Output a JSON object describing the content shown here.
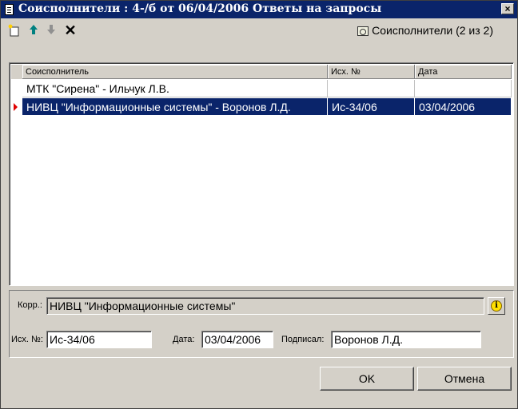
{
  "window": {
    "title": "Соисполнители : 4-/б от 06/04/2006 Ответы на запросы",
    "close_label": "×"
  },
  "toolbar": {
    "add_icon": "new-record-icon",
    "up_icon": "arrow-up-icon",
    "down_icon": "arrow-down-icon",
    "delete_icon": "delete-icon",
    "delete_glyph": "✕",
    "coexecutors_label": "Соисполнители (2 из 2)"
  },
  "grid": {
    "columns": [
      "Соисполнитель",
      "Исх. №",
      "Дата"
    ],
    "rows": [
      {
        "executor": "МТК \"Сирена\" - Ильчук Л.В.",
        "out_no": "",
        "date": ""
      },
      {
        "executor": "НИВЦ \"Информационные системы\" - Воронов Л.Д.",
        "out_no": "Ис-34/06",
        "date": "03/04/2006",
        "selected": true
      }
    ]
  },
  "form": {
    "korr_label": "Корр.:",
    "korr_value": "НИВЦ \"Информационные системы\"",
    "out_no_label": "Исх. №:",
    "out_no_value": "Ис-34/06",
    "date_label": "Дата:",
    "date_value": "03/04/2006",
    "signed_label": "Подписал:",
    "signed_value": "Воронов Л.Д."
  },
  "buttons": {
    "ok": "OK",
    "cancel": "Отмена"
  },
  "colors": {
    "title_bar": "#0a246a",
    "selection": "#0a246a",
    "window_bg": "#d4d0c8",
    "row_indicator": "#e00000"
  }
}
